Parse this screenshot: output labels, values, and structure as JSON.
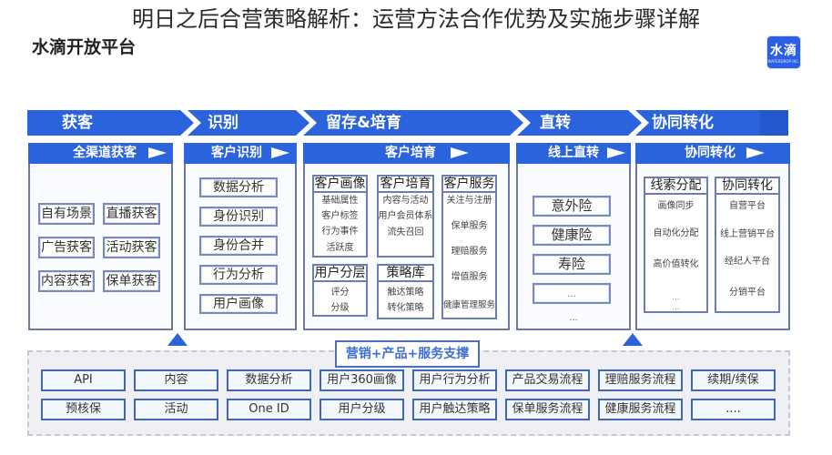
{
  "page": {
    "title": "明日之后合营策略解析：运营方法合作优势及实施步骤详解"
  },
  "header": {
    "platform_name": "水滴开放平台",
    "logo": {
      "text": "水滴",
      "subtext": "WATERDROP INC."
    }
  },
  "stages": [
    {
      "label": "获客"
    },
    {
      "label": "识别"
    },
    {
      "label": "留存&培育"
    },
    {
      "label": "直转"
    },
    {
      "label": "协同转化"
    }
  ],
  "panels": {
    "acquisition": {
      "title": "全渠道获客",
      "items": [
        "自有场景",
        "直播获客",
        "广告获客",
        "活动获客",
        "内容获客",
        "保单获客"
      ]
    },
    "identification": {
      "title": "客户识别",
      "items": [
        "数据分析",
        "身份识别",
        "身份合并",
        "行为分析",
        "用户画像"
      ]
    },
    "cultivation": {
      "title": "客户培育",
      "groups": [
        {
          "title": "客户画像",
          "items": [
            "基础属性",
            "客户标签",
            "行为事件",
            "活跃度"
          ]
        },
        {
          "title": "客户培育",
          "items": [
            "内容与活动",
            "用户会员体系",
            "流失召回"
          ]
        },
        {
          "title": "客户服务",
          "items": [
            "关注与注册",
            "保单服务",
            "理赔服务",
            "增值服务",
            "健康管理服务"
          ]
        },
        {
          "title": "用户分层",
          "items": [
            "评分",
            "分级"
          ]
        },
        {
          "title": "策略库",
          "items": [
            "触达策略",
            "转化策略"
          ]
        }
      ]
    },
    "conversion": {
      "title": "线上直转",
      "items": [
        "意外险",
        "健康险",
        "寿险",
        "..."
      ],
      "more": "..."
    },
    "collaboration": {
      "title": "协同转化",
      "groups": [
        {
          "title": "线索分配",
          "items": [
            "画像同步",
            "自动化分配",
            "高价值转化",
            "...",
            "..."
          ]
        },
        {
          "title": "协同转化",
          "items": [
            "自营平台",
            "线上营销平台",
            "经纪人平台",
            "分销平台"
          ]
        }
      ]
    }
  },
  "support": {
    "title": "营销+产品+服务支撑",
    "rows": [
      [
        "API",
        "内容",
        "数据分析",
        "用户360画像",
        "用户行为分析",
        "产品交易流程",
        "理赔服务流程",
        "续期/续保"
      ],
      [
        "预核保",
        "活动",
        "One ID",
        "用户分级",
        "用户触达策略",
        "保单服务流程",
        "健康服务流程",
        "...."
      ]
    ]
  },
  "icons": {
    "panel_header": "play-arrow-icon",
    "flow_connector": "up-arrow-icon"
  },
  "colors": {
    "brand_blue": "#2b63dc",
    "panel_border": "#6b79a6",
    "support_label_text": "#3d6fd1",
    "support_background": "#eef0f6",
    "support_cell_border": "#4068b0"
  }
}
